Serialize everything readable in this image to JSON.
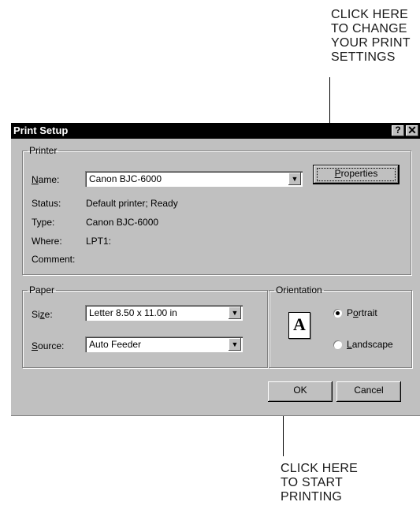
{
  "callouts": {
    "top": [
      "CLICK HERE",
      "TO CHANGE",
      "YOUR PRINT",
      "SETTINGS"
    ],
    "bottom": [
      "CLICK HERE",
      "TO START",
      "PRINTING"
    ]
  },
  "dialog": {
    "title": "Print Setup",
    "help_glyph": "?",
    "close_glyph": "✕",
    "printer": {
      "group_label": "Printer",
      "name_label_u": "N",
      "name_label_rest": "ame:",
      "name_value": "Canon BJC-6000",
      "properties_label_u": "P",
      "properties_label_rest": "roperties",
      "status_label": "Status:",
      "status_value": "Default printer; Ready",
      "type_label": "Type:",
      "type_value": "Canon BJC-6000",
      "where_label": "Where:",
      "where_value": "LPT1:",
      "comment_label": "Comment:",
      "comment_value": ""
    },
    "paper": {
      "group_label": "Paper",
      "size_label_pre": "Si",
      "size_label_u": "z",
      "size_label_rest": "e:",
      "size_value": "Letter 8.50 x 11.00 in",
      "source_label_u": "S",
      "source_label_rest": "ource:",
      "source_value": "Auto Feeder"
    },
    "orientation": {
      "group_label": "Orientation",
      "icon_letter": "A",
      "portrait_pre": "P",
      "portrait_u": "o",
      "portrait_rest": "rtrait",
      "landscape_pre": "",
      "landscape_u": "L",
      "landscape_rest": "andscape",
      "selected": "Portrait"
    },
    "ok_label": "OK",
    "cancel_label": "Cancel"
  }
}
